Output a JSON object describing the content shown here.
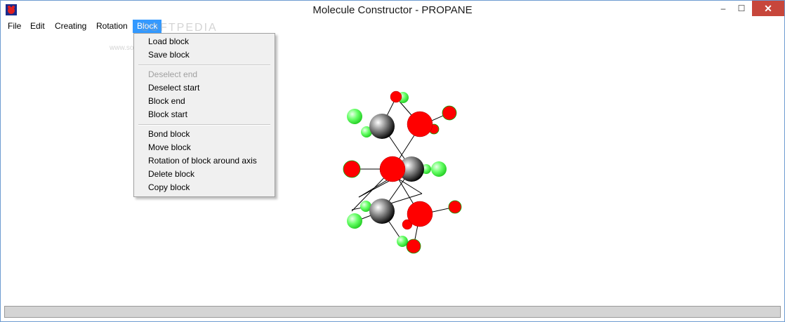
{
  "window": {
    "title": "Molecule Constructor - PROPANE",
    "close_glyph": "✕",
    "minimize_glyph": "–",
    "maximize_glyph": "☐"
  },
  "menubar": {
    "items": [
      "File",
      "Edit",
      "Creating",
      "Rotation",
      "Block"
    ]
  },
  "block_menu": {
    "groups": [
      [
        {
          "label": "Load block",
          "enabled": true
        },
        {
          "label": "Save block",
          "enabled": true
        }
      ],
      [
        {
          "label": "Deselect end",
          "enabled": false
        },
        {
          "label": "Deselect start",
          "enabled": true
        },
        {
          "label": "Block end",
          "enabled": true
        },
        {
          "label": "Block start",
          "enabled": true
        }
      ],
      [
        {
          "label": "Bond block",
          "enabled": true
        },
        {
          "label": "Move block",
          "enabled": true
        },
        {
          "label": "Rotation of block around axis",
          "enabled": true
        },
        {
          "label": "Delete block",
          "enabled": true
        },
        {
          "label": "Copy block",
          "enabled": true
        }
      ]
    ]
  },
  "watermark": {
    "text": "SOFTPEDIA",
    "subtext": "www.softpedia.com"
  },
  "colors": {
    "carbon": "#555555",
    "oxygen": "#ff0000",
    "hydrogen": "#33ee33",
    "menu_highlight": "#3399ff",
    "close_button": "#c7463b"
  }
}
